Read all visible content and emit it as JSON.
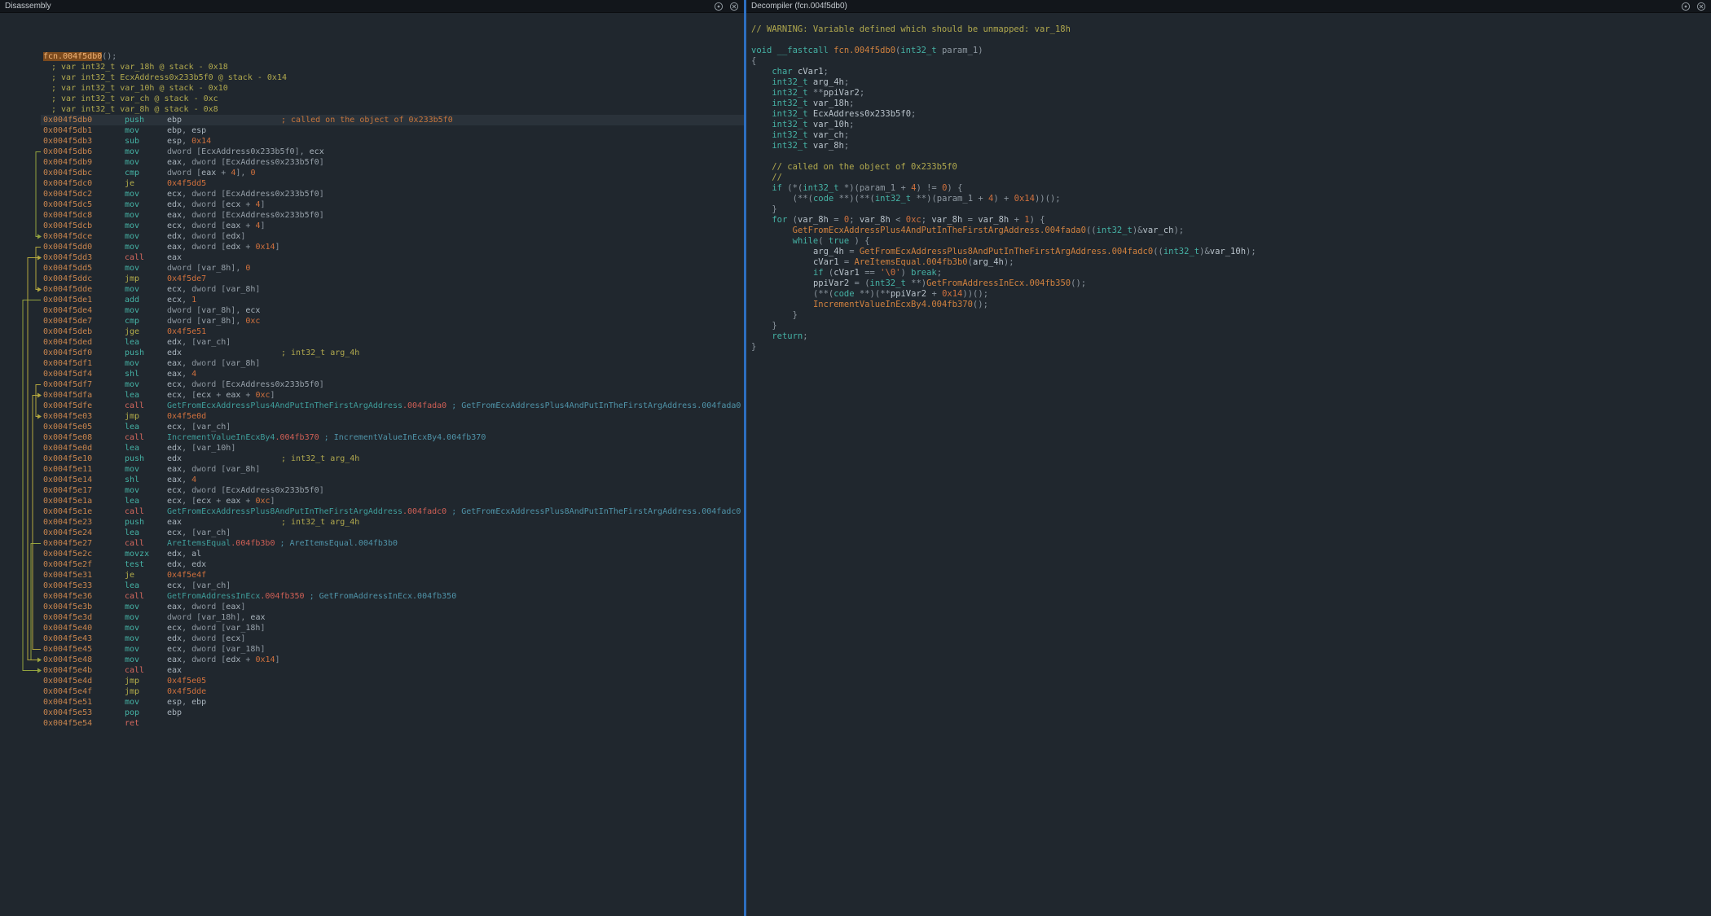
{
  "window": {
    "left_title": "Disassembly",
    "right_title": "Decompiler (fcn.004f5db0)"
  },
  "colors": {
    "background": "#20272e",
    "header_background": "#12161b",
    "splitter_accent": "#2d6fc0",
    "highlight_row": "#2a323a",
    "selection_box_bg": "#7b4a1d",
    "address": "#c9854e",
    "mnemonic": "#45b2a5",
    "call_mnemonic": "#d4685e",
    "jump_mnemonic": "#b4ad4a",
    "number": "#d1713d",
    "function_name": "#3f9e9b",
    "keyword": "#45b2a5",
    "decompiler_function": "#d0813f",
    "comment_yellow": "#b1a94e",
    "comment_orange": "#c8763c",
    "comment_teal": "#4f93a8",
    "arrow_conditional": "#93a33f",
    "arrow_unconditional": "#b3a73e"
  },
  "disassembly": {
    "function_line": {
      "name": "fcn.004f5db0",
      "rest": "();"
    },
    "var_comments": [
      "; var int32_t var_18h @ stack - 0x18",
      "; var int32_t EcxAddress0x233b5f0 @ stack - 0x14",
      "; var int32_t var_10h @ stack - 0x10",
      "; var int32_t var_ch @ stack - 0xc",
      "; var int32_t var_8h @ stack - 0x8"
    ],
    "rows": [
      {
        "a": "0x004f5db0",
        "m": "push",
        "o": "ebp",
        "c": "; called on the object of 0x233b5f0",
        "cc": "o",
        "pad": true,
        "hl": true
      },
      {
        "a": "0x004f5db1",
        "m": "mov",
        "o": "ebp, esp"
      },
      {
        "a": "0x004f5db3",
        "m": "sub",
        "o": "esp, 0x14"
      },
      {
        "a": "0x004f5db6",
        "m": "mov",
        "o": "dword [EcxAddress0x233b5f0], ecx"
      },
      {
        "a": "0x004f5db9",
        "m": "mov",
        "o": "eax, dword [EcxAddress0x233b5f0]"
      },
      {
        "a": "0x004f5dbc",
        "m": "cmp",
        "o": "dword [eax + 4], 0"
      },
      {
        "a": "0x004f5dc0",
        "m": "je",
        "o": "0x4f5dd5"
      },
      {
        "a": "0x004f5dc2",
        "m": "mov",
        "o": "ecx, dword [EcxAddress0x233b5f0]"
      },
      {
        "a": "0x004f5dc5",
        "m": "mov",
        "o": "edx, dword [ecx + 4]"
      },
      {
        "a": "0x004f5dc8",
        "m": "mov",
        "o": "eax, dword [EcxAddress0x233b5f0]"
      },
      {
        "a": "0x004f5dcb",
        "m": "mov",
        "o": "ecx, dword [eax + 4]"
      },
      {
        "a": "0x004f5dce",
        "m": "mov",
        "o": "edx, dword [edx]"
      },
      {
        "a": "0x004f5dd0",
        "m": "mov",
        "o": "eax, dword [edx + 0x14]"
      },
      {
        "a": "0x004f5dd3",
        "m": "call",
        "o": "eax"
      },
      {
        "a": "0x004f5dd5",
        "m": "mov",
        "o": "dword [var_8h], 0"
      },
      {
        "a": "0x004f5ddc",
        "m": "jmp",
        "o": "0x4f5de7"
      },
      {
        "a": "0x004f5dde",
        "m": "mov",
        "o": "ecx, dword [var_8h]"
      },
      {
        "a": "0x004f5de1",
        "m": "add",
        "o": "ecx, 1"
      },
      {
        "a": "0x004f5de4",
        "m": "mov",
        "o": "dword [var_8h], ecx"
      },
      {
        "a": "0x004f5de7",
        "m": "cmp",
        "o": "dword [var_8h], 0xc"
      },
      {
        "a": "0x004f5deb",
        "m": "jge",
        "o": "0x4f5e51"
      },
      {
        "a": "0x004f5ded",
        "m": "lea",
        "o": "edx, [var_ch]"
      },
      {
        "a": "0x004f5df0",
        "m": "push",
        "o": "edx",
        "c": "; int32_t arg_4h",
        "cc": "y",
        "pad": true
      },
      {
        "a": "0x004f5df1",
        "m": "mov",
        "o": "eax, dword [var_8h]"
      },
      {
        "a": "0x004f5df4",
        "m": "shl",
        "o": "eax, 4"
      },
      {
        "a": "0x004f5df7",
        "m": "mov",
        "o": "ecx, dword [EcxAddress0x233b5f0]"
      },
      {
        "a": "0x004f5dfa",
        "m": "lea",
        "o": "ecx, [ecx + eax + 0xc]"
      },
      {
        "a": "0x004f5dfe",
        "m": "call",
        "o": "GetFromEcxAddressPlus4AndPutInTheFirstArgAddress.004fada0",
        "c": "; GetFromEcxAddressPlus4AndPutInTheFirstArgAddress.004fada0",
        "cc": "t"
      },
      {
        "a": "0x004f5e03",
        "m": "jmp",
        "o": "0x4f5e0d"
      },
      {
        "a": "0x004f5e05",
        "m": "lea",
        "o": "ecx, [var_ch]"
      },
      {
        "a": "0x004f5e08",
        "m": "call",
        "o": "IncrementValueInEcxBy4.004fb370",
        "c": "; IncrementValueInEcxBy4.004fb370",
        "cc": "t"
      },
      {
        "a": "0x004f5e0d",
        "m": "lea",
        "o": "edx, [var_10h]"
      },
      {
        "a": "0x004f5e10",
        "m": "push",
        "o": "edx",
        "c": "; int32_t arg_4h",
        "cc": "y",
        "pad": true
      },
      {
        "a": "0x004f5e11",
        "m": "mov",
        "o": "eax, dword [var_8h]"
      },
      {
        "a": "0x004f5e14",
        "m": "shl",
        "o": "eax, 4"
      },
      {
        "a": "0x004f5e17",
        "m": "mov",
        "o": "ecx, dword [EcxAddress0x233b5f0]"
      },
      {
        "a": "0x004f5e1a",
        "m": "lea",
        "o": "ecx, [ecx + eax + 0xc]"
      },
      {
        "a": "0x004f5e1e",
        "m": "call",
        "o": "GetFromEcxAddressPlus8AndPutInTheFirstArgAddress.004fadc0",
        "c": "; GetFromEcxAddressPlus8AndPutInTheFirstArgAddress.004fadc0",
        "cc": "t"
      },
      {
        "a": "0x004f5e23",
        "m": "push",
        "o": "eax",
        "c": "; int32_t arg_4h",
        "cc": "y",
        "pad": true
      },
      {
        "a": "0x004f5e24",
        "m": "lea",
        "o": "ecx, [var_ch]"
      },
      {
        "a": "0x004f5e27",
        "m": "call",
        "o": "AreItemsEqual.004fb3b0",
        "c": "; AreItemsEqual.004fb3b0",
        "cc": "t"
      },
      {
        "a": "0x004f5e2c",
        "m": "movzx",
        "o": "edx, al"
      },
      {
        "a": "0x004f5e2f",
        "m": "test",
        "o": "edx, edx"
      },
      {
        "a": "0x004f5e31",
        "m": "je",
        "o": "0x4f5e4f"
      },
      {
        "a": "0x004f5e33",
        "m": "lea",
        "o": "ecx, [var_ch]"
      },
      {
        "a": "0x004f5e36",
        "m": "call",
        "o": "GetFromAddressInEcx.004fb350",
        "c": "; GetFromAddressInEcx.004fb350",
        "cc": "t"
      },
      {
        "a": "0x004f5e3b",
        "m": "mov",
        "o": "eax, dword [eax]"
      },
      {
        "a": "0x004f5e3d",
        "m": "mov",
        "o": "dword [var_18h], eax"
      },
      {
        "a": "0x004f5e40",
        "m": "mov",
        "o": "ecx, dword [var_18h]"
      },
      {
        "a": "0x004f5e43",
        "m": "mov",
        "o": "edx, dword [ecx]"
      },
      {
        "a": "0x004f5e45",
        "m": "mov",
        "o": "ecx, dword [var_18h]"
      },
      {
        "a": "0x004f5e48",
        "m": "mov",
        "o": "eax, dword [edx + 0x14]"
      },
      {
        "a": "0x004f5e4b",
        "m": "call",
        "o": "eax"
      },
      {
        "a": "0x004f5e4d",
        "m": "jmp",
        "o": "0x4f5e05"
      },
      {
        "a": "0x004f5e4f",
        "m": "jmp",
        "o": "0x4f5dde"
      },
      {
        "a": "0x004f5e51",
        "m": "mov",
        "o": "esp, ebp"
      },
      {
        "a": "0x004f5e53",
        "m": "pop",
        "o": "ebp"
      },
      {
        "a": "0x004f5e54",
        "m": "ret",
        "o": ""
      }
    ],
    "arrows": [
      {
        "from": 6,
        "to": 14,
        "x": 44,
        "cond": true
      },
      {
        "from": 15,
        "to": 19,
        "x": 44,
        "cond": false
      },
      {
        "from": 20,
        "to": 55,
        "x": 28,
        "cond": true
      },
      {
        "from": 28,
        "to": 31,
        "x": 44,
        "cond": false
      },
      {
        "from": 43,
        "to": 54,
        "x": 38,
        "cond": true
      },
      {
        "from": 53,
        "to": 29,
        "x": 40,
        "cond": false
      },
      {
        "from": 54,
        "to": 16,
        "x": 34,
        "cond": false
      }
    ]
  },
  "decompiler": {
    "lines": [
      "// WARNING: Variable defined which should be unmapped: var_18h",
      "",
      "void __fastcall fcn.004f5db0(int32_t param_1)",
      "{",
      "    char cVar1;",
      "    int32_t arg_4h;",
      "    int32_t **ppiVar2;",
      "    int32_t var_18h;",
      "    int32_t EcxAddress0x233b5f0;",
      "    int32_t var_10h;",
      "    int32_t var_ch;",
      "    int32_t var_8h;",
      "",
      "    // called on the object of 0x233b5f0",
      "    //",
      "    if (*(int32_t *)(param_1 + 4) != 0) {",
      "        (**(code **)(**(int32_t **)(param_1 + 4) + 0x14))();",
      "    }",
      "    for (var_8h = 0; var_8h < 0xc; var_8h = var_8h + 1) {",
      "        GetFromEcxAddressPlus4AndPutInTheFirstArgAddress.004fada0((int32_t)&var_ch);",
      "        while( true ) {",
      "            arg_4h = GetFromEcxAddressPlus8AndPutInTheFirstArgAddress.004fadc0((int32_t)&var_10h);",
      "            cVar1 = AreItemsEqual.004fb3b0(arg_4h);",
      "            if (cVar1 == '\\0') break;",
      "            ppiVar2 = (int32_t **)GetFromAddressInEcx.004fb350();",
      "            (**(code **)(**ppiVar2 + 0x14))();",
      "            IncrementValueInEcxBy4.004fb370();",
      "        }",
      "    }",
      "    return;",
      "}"
    ]
  }
}
